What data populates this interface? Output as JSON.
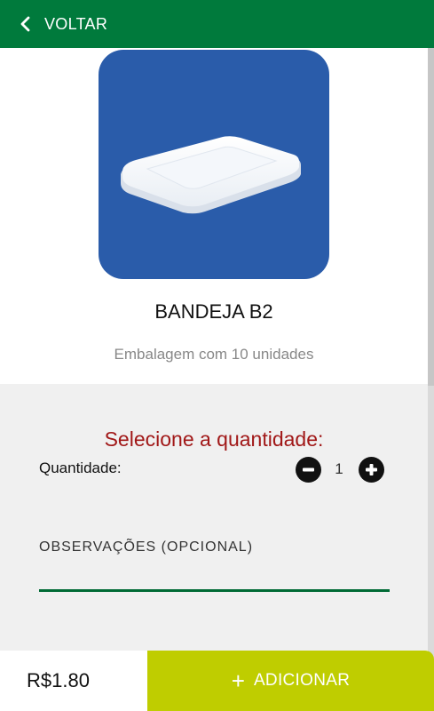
{
  "header": {
    "back_label": "VOLTAR",
    "background": "#007a3c"
  },
  "product": {
    "name": "BANDEJA B2",
    "description": "Embalagem com 10 unidades",
    "image_background": "#2a5caa"
  },
  "quantity": {
    "title": "Selecione a quantidade:",
    "label": "Quantidade:",
    "value": "1"
  },
  "observations": {
    "label": "OBSERVAÇÕES (OPCIONAL)",
    "value": ""
  },
  "footer": {
    "price": "R$1.80",
    "add_label": "ADICIONAR",
    "add_icon": "+",
    "add_background": "#bfcd00"
  },
  "icons": [
    "chevron-left-icon",
    "minus-circle-icon",
    "plus-circle-icon",
    "plus-icon"
  ]
}
